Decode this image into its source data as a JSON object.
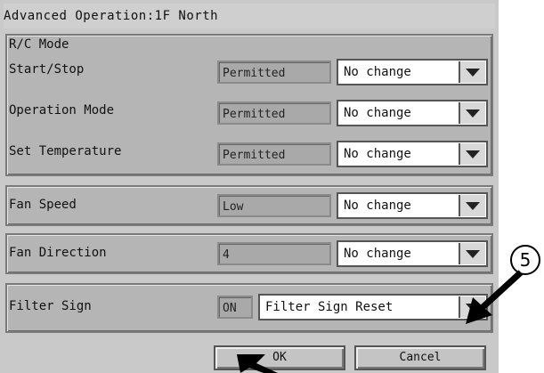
{
  "window": {
    "title": "Advanced Operation:1F North"
  },
  "rc_mode": {
    "header": "R/C Mode",
    "rows": [
      {
        "label": "Start/Stop",
        "status": "Permitted",
        "value": "No change"
      },
      {
        "label": "Operation Mode",
        "status": "Permitted",
        "value": "No change"
      },
      {
        "label": "Set Temperature",
        "status": "Permitted",
        "value": "No change"
      }
    ]
  },
  "fan_speed": {
    "label": "Fan Speed",
    "status": "Low",
    "value": "No change"
  },
  "fan_direction": {
    "label": "Fan Direction",
    "status": "4",
    "value": "No change"
  },
  "filter_sign": {
    "label": "Filter Sign",
    "status": "ON",
    "value": "Filter Sign Reset"
  },
  "buttons": {
    "ok": "OK",
    "cancel": "Cancel"
  },
  "annotation": {
    "callout_number": "5"
  },
  "icons": {
    "dropdown": "triangle-down-icon",
    "arrow": "arrow-icon"
  }
}
